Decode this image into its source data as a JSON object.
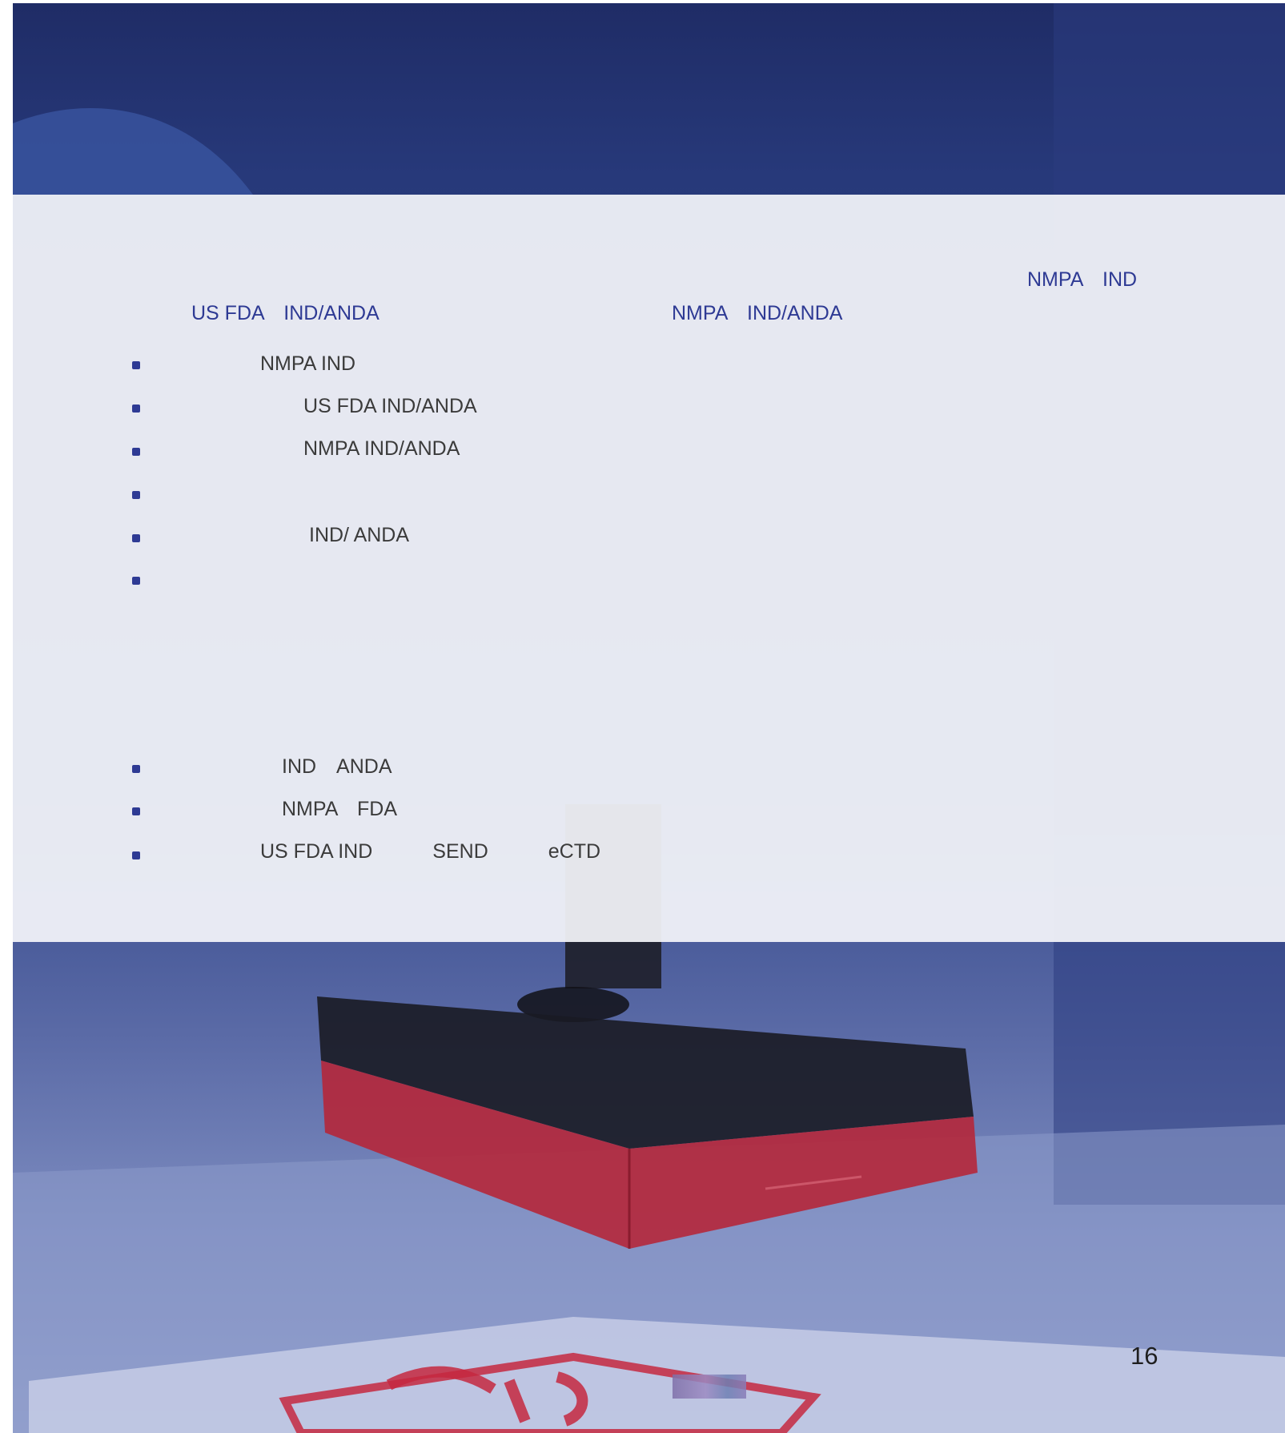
{
  "header_labels": {
    "nmpa_ind_top_right": "NMPA　IND",
    "us_fda_ind_anda": "US FDA　IND/ANDA",
    "nmpa_ind_anda": "NMPA　IND/ANDA"
  },
  "service_bullets": [
    {
      "text": "NMPA IND"
    },
    {
      "text": "US FDA IND/ANDA"
    },
    {
      "text": "NMPA IND/ANDA"
    },
    {
      "text": ""
    },
    {
      "text": "IND/ ANDA"
    },
    {
      "text": ""
    }
  ],
  "advantage_bullets": [
    {
      "text": "IND　ANDA"
    },
    {
      "text": "NMPA　FDA"
    },
    {
      "text": "US FDA IND　　　SEND　　　eCTD"
    }
  ],
  "page_number": "16",
  "colors": {
    "accent_blue": "#2e3a94",
    "body_text": "#3b3b3b",
    "panel_background": "#f4f5fa",
    "stamp_red": "#c6283f"
  }
}
